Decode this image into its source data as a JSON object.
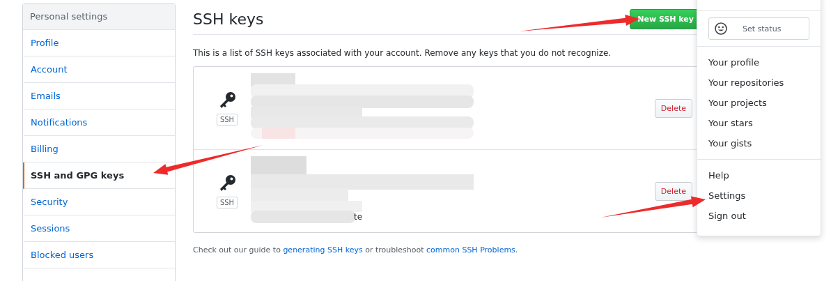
{
  "sidebar": {
    "heading": "Personal settings",
    "items": [
      {
        "label": "Profile",
        "selected": false
      },
      {
        "label": "Account",
        "selected": false
      },
      {
        "label": "Emails",
        "selected": false
      },
      {
        "label": "Notifications",
        "selected": false
      },
      {
        "label": "Billing",
        "selected": false
      },
      {
        "label": "SSH and GPG keys",
        "selected": true
      },
      {
        "label": "Security",
        "selected": false
      },
      {
        "label": "Sessions",
        "selected": false
      },
      {
        "label": "Blocked users",
        "selected": false
      }
    ]
  },
  "main": {
    "title": "SSH keys",
    "new_button": "New SSH key",
    "description": "This is a list of SSH keys associated with your account. Remove any keys that you do not recognize.",
    "keys": [
      {
        "badge": "SSH",
        "delete": "Delete"
      },
      {
        "badge": "SSH",
        "delete": "Delete",
        "visible_fragment": "te"
      }
    ],
    "footer": {
      "before": "Check out our guide to ",
      "link1": "generating SSH keys",
      "middle": " or troubleshoot ",
      "link2": "common SSH Problems",
      "after": "."
    }
  },
  "dropdown": {
    "status_button": "Set status",
    "groups": [
      [
        "Your profile",
        "Your repositories",
        "Your projects",
        "Your stars",
        "Your gists"
      ],
      [
        "Help",
        "Settings",
        "Sign out"
      ]
    ]
  }
}
